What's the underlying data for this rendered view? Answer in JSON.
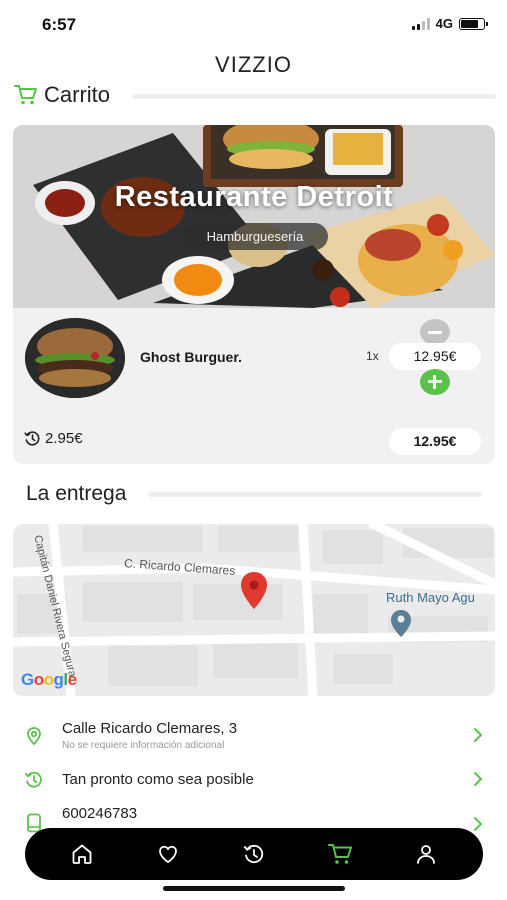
{
  "status_bar": {
    "time": "6:57",
    "network": "4G"
  },
  "app": {
    "title": "VIZZIO"
  },
  "cart": {
    "heading": "Carrito",
    "restaurant": {
      "name": "Restaurante Detroit",
      "category": "Hamburguesería"
    },
    "items": [
      {
        "name": "Ghost Burguer.",
        "quantity": "1x",
        "price": "12.95€"
      }
    ],
    "delivery_fee": "2.95€",
    "total": "12.95€"
  },
  "delivery": {
    "heading": "La entrega",
    "map": {
      "street_1": "C. Ricardo Clemares",
      "street_2": "Capitán Daniel Rivera Segura",
      "place": "Ruth Mayo Agu",
      "provider": "Google"
    },
    "address": {
      "main": "Calle Ricardo Clemares, 3",
      "sub": "No se requiere información adicional"
    },
    "time": "Tan pronto como sea posible",
    "phone": "600246783"
  },
  "nav": {
    "items": [
      {
        "icon": "home-icon",
        "active": false
      },
      {
        "icon": "heart-icon",
        "active": false
      },
      {
        "icon": "history-icon",
        "active": false
      },
      {
        "icon": "cart-icon",
        "active": true
      },
      {
        "icon": "user-icon",
        "active": false
      }
    ]
  },
  "colors": {
    "accent": "#5ac24a",
    "nav_bg": "#000000",
    "card_bg": "#f1f1f1"
  }
}
